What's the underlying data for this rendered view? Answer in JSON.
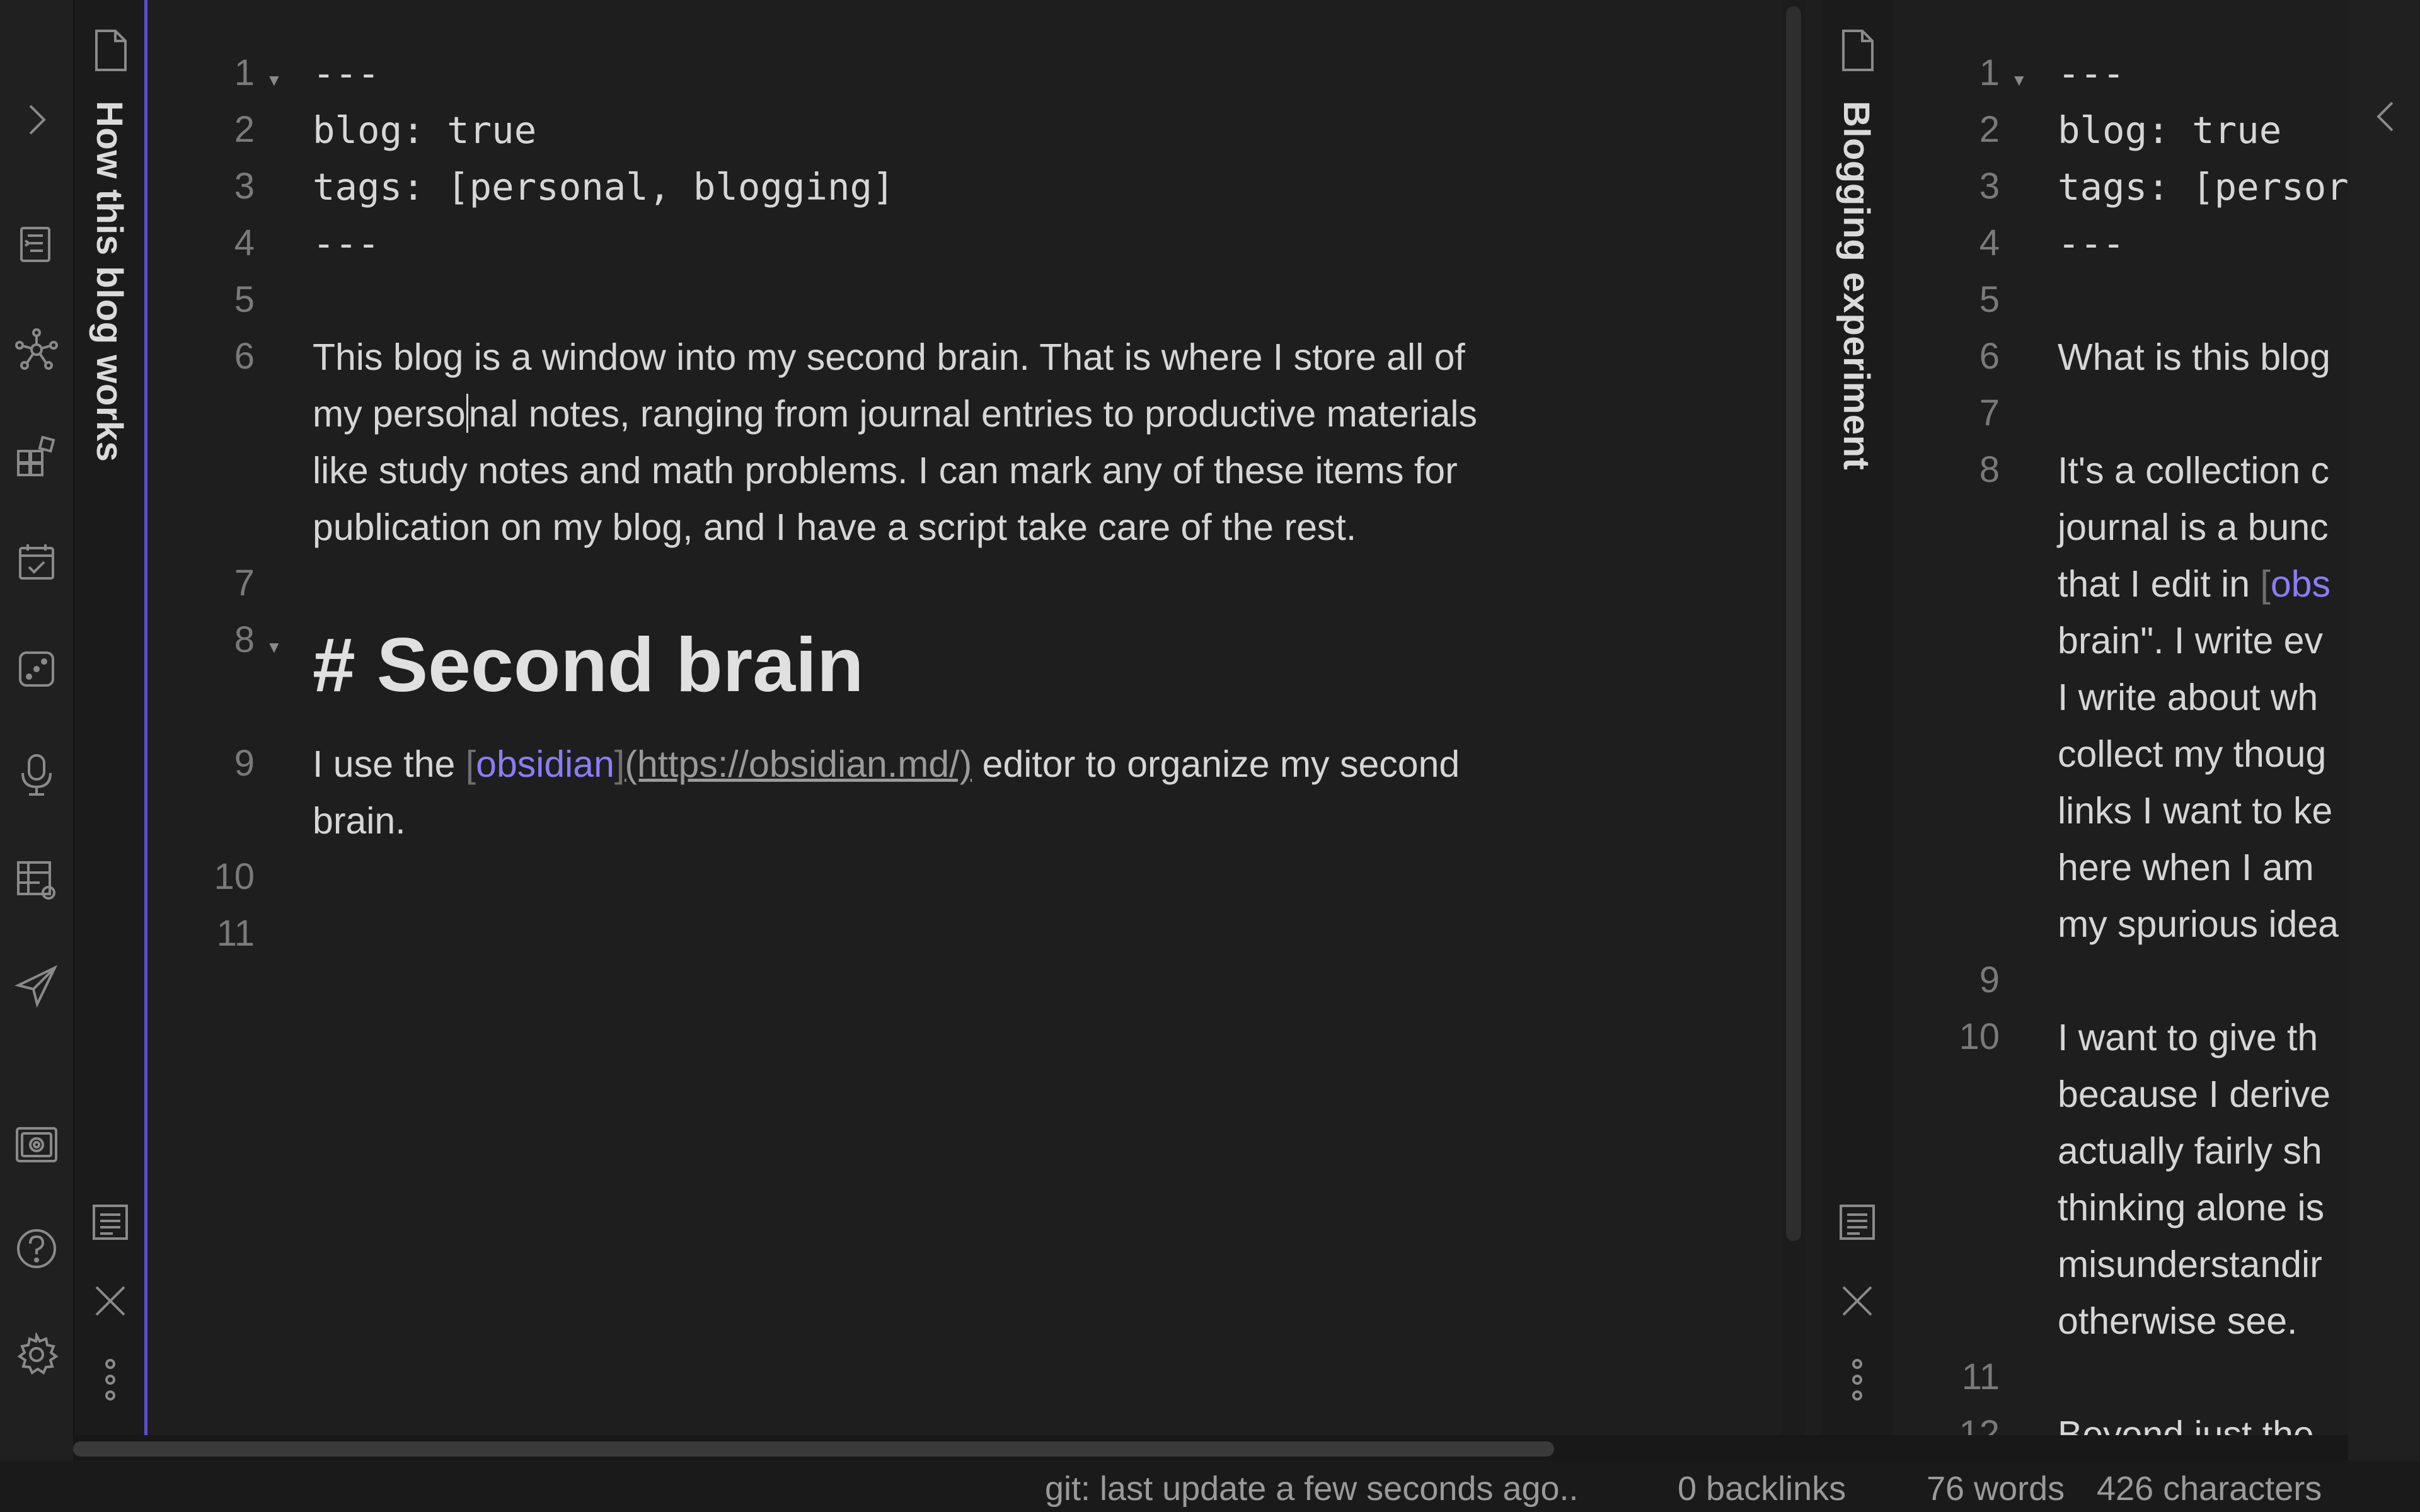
{
  "ribbon": {
    "icons": [
      "expand-chevron-icon",
      "quick-switcher-icon",
      "graph-view-icon",
      "plugins-grid-icon",
      "daily-note-calendar-icon",
      "random-note-dice-icon",
      "microphone-icon",
      "table-settings-icon",
      "publish-send-icon",
      "vault-icon",
      "help-icon",
      "settings-gear-icon"
    ]
  },
  "left_pane": {
    "title": "How this blog works",
    "lines": {
      "l1": {
        "num": "1",
        "text": "---"
      },
      "l2": {
        "num": "2",
        "text": "blog: true"
      },
      "l3": {
        "num": "3",
        "text": "tags: [personal, blogging]"
      },
      "l4": {
        "num": "4",
        "text": "---"
      },
      "l5": {
        "num": "5"
      },
      "l6": {
        "num": "6",
        "w1": "This blog is a window into my second brain. That is where I store all of",
        "w2a": "my perso",
        "w2b": "nal notes, ranging from journal entries to productive materials",
        "w3": "like study notes and math problems. I can mark any of these items for",
        "w4": "publication on my blog, and I have a script take care of the rest."
      },
      "l7": {
        "num": "7"
      },
      "l8": {
        "num": "8",
        "text": "# Second brain"
      },
      "l9": {
        "num": "9",
        "pre": "I use the ",
        "lb": "[",
        "link": "obsidian",
        "rb": "]",
        "url": "(https://obsidian.md/)",
        "post": " editor to organize my second",
        "w2": "brain."
      },
      "l10": {
        "num": "10"
      },
      "l11": {
        "num": "11"
      }
    }
  },
  "right_pane": {
    "title": "Blogging experiment",
    "lines": {
      "l1": {
        "num": "1",
        "text": "---"
      },
      "l2": {
        "num": "2",
        "text": "blog: true"
      },
      "l3": {
        "num": "3",
        "text": "tags: [persor"
      },
      "l4": {
        "num": "4",
        "text": "---"
      },
      "l5": {
        "num": "5"
      },
      "l6": {
        "num": "6",
        "text": "What is this blog"
      },
      "l7": {
        "num": "7"
      },
      "l8": {
        "num": "8",
        "w1": "It's a collection c",
        "w2": "journal is a bunc",
        "w3a": "that I edit in ",
        "w3b": "[",
        "w3c": "obs",
        "w4": "brain\". I write ev",
        "w5": "I write about wh",
        "w6": "collect my thoug",
        "w7": "links I want to ke",
        "w8": "here when I am",
        "w9": "my spurious idea"
      },
      "l9": {
        "num": "9"
      },
      "l10": {
        "num": "10",
        "w1": "I want to give th",
        "w2": "because I derive",
        "w3": "actually fairly sh",
        "w4": "thinking alone is",
        "w5": "misunderstandir",
        "w6": "otherwise see."
      },
      "l11": {
        "num": "11"
      },
      "l12": {
        "num": "12",
        "text": "Beyond just the"
      }
    }
  },
  "status_bar": {
    "git": "git: last update a few seconds ago..",
    "backlinks": "0 backlinks",
    "words": "76 words",
    "chars": "426 characters"
  },
  "colors": {
    "accent": "#8b7cf6",
    "background": "#1e1e1e",
    "active_pane_border": "#5a4fcf"
  }
}
